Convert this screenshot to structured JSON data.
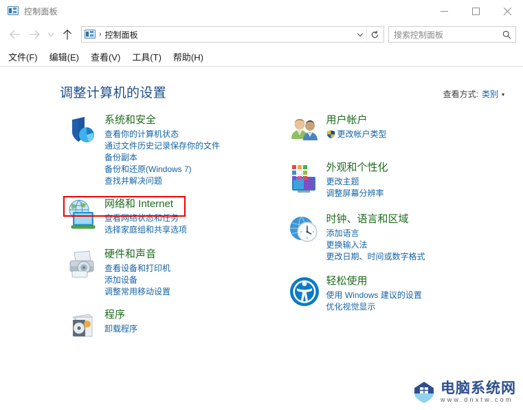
{
  "window": {
    "title": "控制面板",
    "icon": "control-panel-icon",
    "minimize_label": "—",
    "maximize_label": "□",
    "close_label": "✕"
  },
  "navbar": {
    "back_icon": "arrow-left-icon",
    "forward_icon": "arrow-right-icon",
    "recent_icon": "chevron-down-icon",
    "up_icon": "arrow-up-icon",
    "address_icon": "control-panel-icon",
    "address_separator": "›",
    "address_text": "控制面板",
    "dropdown_icon": "chevron-down-icon",
    "refresh_icon": "refresh-icon",
    "search_placeholder": "搜索控制面板",
    "search_value": "",
    "search_icon": "search-icon"
  },
  "menubar": {
    "items": [
      {
        "text": "文件(F)",
        "label": "文件",
        "mnemonic": "F"
      },
      {
        "text": "编辑(E)",
        "label": "编辑",
        "mnemonic": "E"
      },
      {
        "text": "查看(V)",
        "label": "查看",
        "mnemonic": "V"
      },
      {
        "text": "工具(T)",
        "label": "工具",
        "mnemonic": "T"
      },
      {
        "text": "帮助(H)",
        "label": "帮助",
        "mnemonic": "H"
      }
    ]
  },
  "page": {
    "title": "调整计算机的设置",
    "viewby_label": "查看方式:",
    "viewby_value": "类别",
    "viewby_caret": "▾"
  },
  "categories": {
    "left": [
      {
        "title": "系统和安全",
        "icon": "shield-security-icon",
        "links": [
          "查看你的计算机状态",
          "通过文件历史记录保存你的文件",
          "备份副本",
          "备份和还原(Windows 7)",
          "查找并解决问题"
        ]
      },
      {
        "title": "网络和 Internet",
        "icon": "network-globe-icon",
        "highlighted": true,
        "links": [
          "查看网络状态和任务",
          "选择家庭组和共享选项"
        ]
      },
      {
        "title": "硬件和声音",
        "icon": "printer-hardware-icon",
        "links": [
          "查看设备和打印机",
          "添加设备",
          "调整常用移动设置"
        ]
      },
      {
        "title": "程序",
        "icon": "programs-disc-icon",
        "links": [
          "卸载程序"
        ]
      }
    ],
    "right": [
      {
        "title": "用户帐户",
        "icon": "user-accounts-icon",
        "links": [
          "更改帐户类型"
        ],
        "shield_on_first_link": true
      },
      {
        "title": "外观和个性化",
        "icon": "appearance-personalization-icon",
        "links": [
          "更改主题",
          "调整屏幕分辨率"
        ]
      },
      {
        "title": "时钟、语言和区域",
        "icon": "clock-language-region-icon",
        "links": [
          "添加语言",
          "更换输入法",
          "更改日期、时间或数字格式"
        ]
      },
      {
        "title": "轻松使用",
        "icon": "ease-of-access-icon",
        "links": [
          "使用 Windows 建议的设置",
          "优化视觉显示"
        ]
      }
    ]
  },
  "watermark": {
    "title": "电脑系统网",
    "url": "www.dnxtw.com",
    "badge_icon": "house-shield-logo"
  },
  "colors": {
    "category_title": "#1a7a1a",
    "link": "#1464a5",
    "page_title": "#1c4e8a",
    "highlight_box": "#ee0000",
    "watermark_title": "#2d4f8e"
  }
}
